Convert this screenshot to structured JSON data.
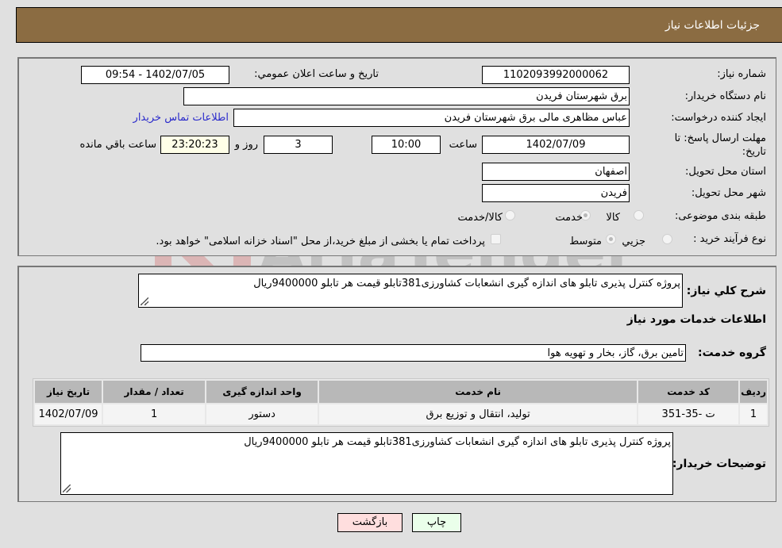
{
  "header": {
    "title": "جزئیات اطلاعات نیاز"
  },
  "form": {
    "need_number": {
      "label": "شماره نیاز:",
      "value": "1102093992000062"
    },
    "announce": {
      "label": "تاریخ و ساعت اعلان عمومي:",
      "value": "1402/07/05 - 09:54"
    },
    "buyer_org": {
      "label": "نام دستگاه خریدار:",
      "value": "برق شهرستان فریدن"
    },
    "creator": {
      "label": "ایجاد کننده درخواست:",
      "value": "عباس مظاهری مالی برق شهرستان فریدن"
    },
    "contact_link": "اطلاعات تماس خریدار",
    "deadline": {
      "label": "مهلت ارسال پاسخ: تا تاریخ:",
      "date": "1402/07/09",
      "time_label": "ساعت",
      "time": "10:00",
      "days": "3",
      "days_label": "روز و",
      "remaining": "23:20:23",
      "remaining_label": "ساعت باقي مانده"
    },
    "province": {
      "label": "استان محل تحویل:",
      "value": "اصفهان"
    },
    "city": {
      "label": "شهر محل تحویل:",
      "value": "فریدن"
    },
    "category": {
      "label": "طبقه بندی موضوعی:",
      "options": [
        "کالا",
        "خدمت",
        "کالا/خدمت"
      ],
      "selected": "خدمت"
    },
    "purchase_type": {
      "label": "نوع فرآیند خرید :",
      "options": [
        "جزيي",
        "متوسط"
      ],
      "selected": "متوسط",
      "treasury_note": "پرداخت تمام یا بخشی از مبلغ خرید،از محل \"اسناد خزانه اسلامی\" خواهد بود."
    }
  },
  "details": {
    "description_label": "شرح کلي نیاز:",
    "description": "پروژه کنترل پذیری تابلو های اندازه گیری انشعابات کشاورزی381تابلو قیمت هر تابلو 9400000ریال",
    "services_title": "اطلاعات خدمات مورد نیاز",
    "service_group_label": "گروه خدمت:",
    "service_group": "تامین برق، گاز، بخار و تهویه هوا",
    "table": {
      "headers": [
        "ردیف",
        "کد خدمت",
        "نام خدمت",
        "واحد اندازه گیری",
        "تعداد / مقدار",
        "تاریخ نیاز"
      ],
      "rows": [
        [
          "1",
          "ت -35-351",
          "تولید، انتقال و توزیع برق",
          "دستور",
          "1",
          "1402/07/09"
        ]
      ]
    },
    "buyer_notes_label": "توضیحات خریدار:",
    "buyer_notes": "پروژه کنترل پذیری تابلو های اندازه گیری انشعابات کشاورزی381تابلو قیمت هر تابلو 9400000ریال"
  },
  "buttons": {
    "print": "چاپ",
    "back": "بازگشت"
  },
  "watermark": "AriaTender.neT",
  "colors": {
    "header_bg": "#8b6c42",
    "print_bg": "#eaffea",
    "back_bg": "#ffdede",
    "link": "#2a2acb"
  }
}
